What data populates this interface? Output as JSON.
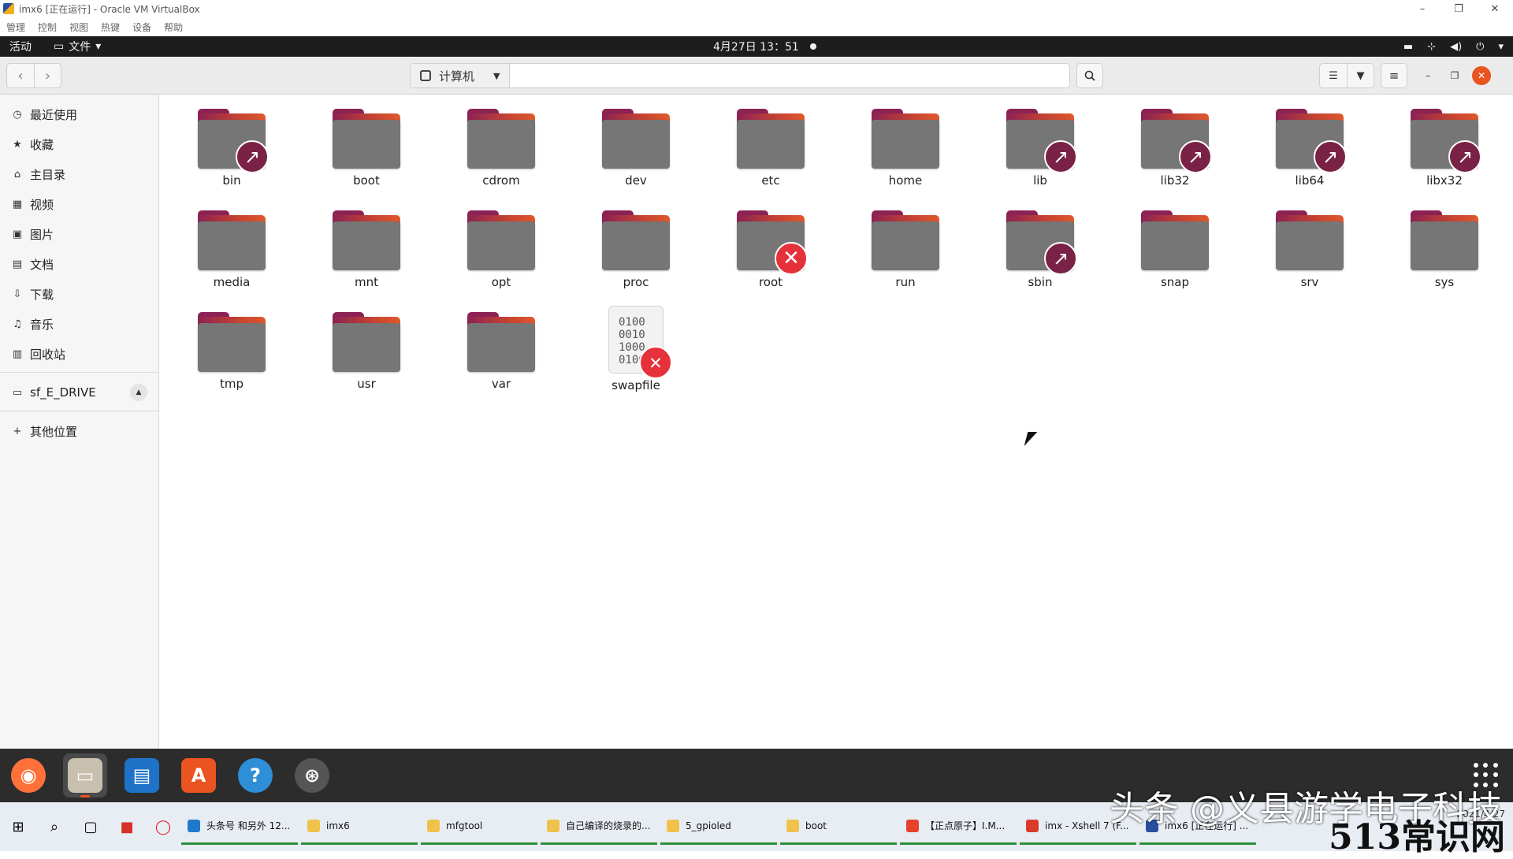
{
  "vbox": {
    "title": "imx6 [正在运行] - Oracle VM VirtualBox",
    "menu": [
      "管理",
      "控制",
      "视图",
      "热键",
      "设备",
      "帮助"
    ],
    "controls": [
      "–",
      "❐",
      "✕"
    ]
  },
  "topbar": {
    "activities": "活动",
    "app_menu": "文件",
    "clock": "4月27日 13：51"
  },
  "headerbar": {
    "location": "计算机",
    "back_glyph": "‹",
    "forward_glyph": "›"
  },
  "sidebar": {
    "items": [
      {
        "label": "最近使用",
        "icon": "clock-icon",
        "glyph": "◷"
      },
      {
        "label": "收藏",
        "icon": "star-icon",
        "glyph": "★"
      },
      {
        "label": "主目录",
        "icon": "home-icon",
        "glyph": "⌂"
      },
      {
        "label": "视频",
        "icon": "film-icon",
        "glyph": "▦"
      },
      {
        "label": "图片",
        "icon": "picture-icon",
        "glyph": "▣"
      },
      {
        "label": "文档",
        "icon": "document-icon",
        "glyph": "▤"
      },
      {
        "label": "下载",
        "icon": "download-icon",
        "glyph": "⇩"
      },
      {
        "label": "音乐",
        "icon": "music-icon",
        "glyph": "♫"
      },
      {
        "label": "回收站",
        "icon": "trash-icon",
        "glyph": "▥"
      }
    ],
    "drive": {
      "label": "sf_E_DRIVE",
      "icon": "drive-icon",
      "glyph": "▭"
    },
    "other": {
      "label": "其他位置",
      "icon": "plus-icon",
      "glyph": "+"
    }
  },
  "files": [
    {
      "name": "bin",
      "emblem": "link"
    },
    {
      "name": "boot",
      "emblem": ""
    },
    {
      "name": "cdrom",
      "emblem": ""
    },
    {
      "name": "dev",
      "emblem": ""
    },
    {
      "name": "etc",
      "emblem": ""
    },
    {
      "name": "home",
      "emblem": ""
    },
    {
      "name": "lib",
      "emblem": "link"
    },
    {
      "name": "lib32",
      "emblem": "link"
    },
    {
      "name": "lib64",
      "emblem": "link"
    },
    {
      "name": "libx32",
      "emblem": "link"
    },
    {
      "name": "media",
      "emblem": ""
    },
    {
      "name": "mnt",
      "emblem": ""
    },
    {
      "name": "opt",
      "emblem": ""
    },
    {
      "name": "proc",
      "emblem": ""
    },
    {
      "name": "root",
      "emblem": "locked"
    },
    {
      "name": "run",
      "emblem": ""
    },
    {
      "name": "sbin",
      "emblem": "link"
    },
    {
      "name": "snap",
      "emblem": ""
    },
    {
      "name": "srv",
      "emblem": ""
    },
    {
      "name": "sys",
      "emblem": ""
    },
    {
      "name": "tmp",
      "emblem": ""
    },
    {
      "name": "usr",
      "emblem": ""
    },
    {
      "name": "var",
      "emblem": ""
    },
    {
      "name": "swapfile",
      "emblem": "locked",
      "kind": "binary"
    }
  ],
  "binary_glyph": "0100\n0010\n1000\n0100",
  "emblem_glyphs": {
    "link": "↗",
    "locked": "✕"
  },
  "dock": [
    {
      "name": "firefox-icon",
      "color": "#ff7139"
    },
    {
      "name": "files-icon",
      "color": "#c9bfae",
      "active": true
    },
    {
      "name": "writer-icon",
      "color": "#1e73c9"
    },
    {
      "name": "software-icon",
      "color": "#e95420"
    },
    {
      "name": "help-icon",
      "color": "#2f8ed8"
    },
    {
      "name": "updater-icon",
      "color": "#555555"
    }
  ],
  "taskbar": {
    "items": [
      {
        "label": "头条号 和另外 12...",
        "color": "#1f7acb"
      },
      {
        "label": "imx6",
        "color": "#f0c24b"
      },
      {
        "label": "mfgtool",
        "color": "#f0c24b"
      },
      {
        "label": "自己编译的烧录的...",
        "color": "#f0c24b"
      },
      {
        "label": "5_gpioled",
        "color": "#f0c24b"
      },
      {
        "label": "boot",
        "color": "#f0c24b"
      },
      {
        "label": "【正点原子】I.M...",
        "color": "#e8412c"
      },
      {
        "label": "imx - Xshell 7 (F...",
        "color": "#d93a2b"
      },
      {
        "label": "imx6 [正在运行] ...",
        "color": "#2a4fa0"
      }
    ],
    "date": "2021/4/27"
  },
  "watermark": "头条 @义县游学电子科技",
  "watermark2": "513常识网"
}
